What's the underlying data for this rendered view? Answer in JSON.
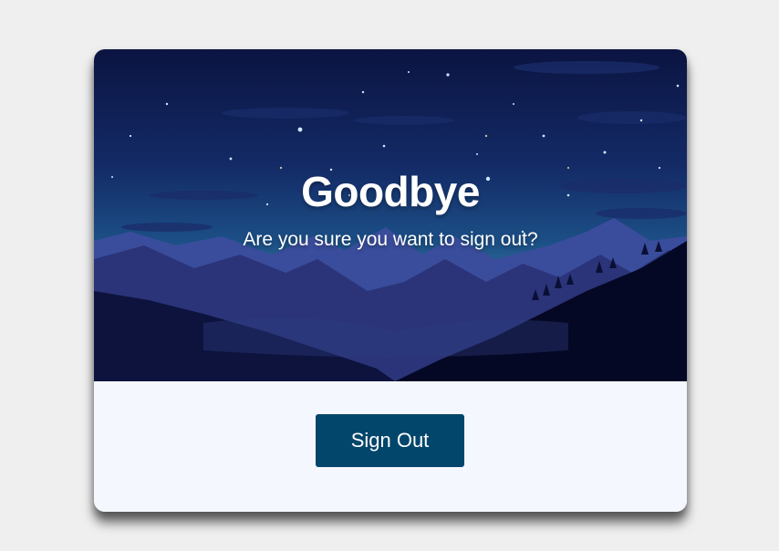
{
  "dialog": {
    "title": "Goodbye",
    "subtitle": "Are you sure you want to sign out?",
    "sign_out_label": "Sign Out"
  },
  "colors": {
    "page_background": "#efefef",
    "card_background": "#f4f7fd",
    "button_background": "#03466b",
    "text_on_image": "#ffffff"
  },
  "hero_image": {
    "subject": "night-sky-mountains-illustration"
  }
}
